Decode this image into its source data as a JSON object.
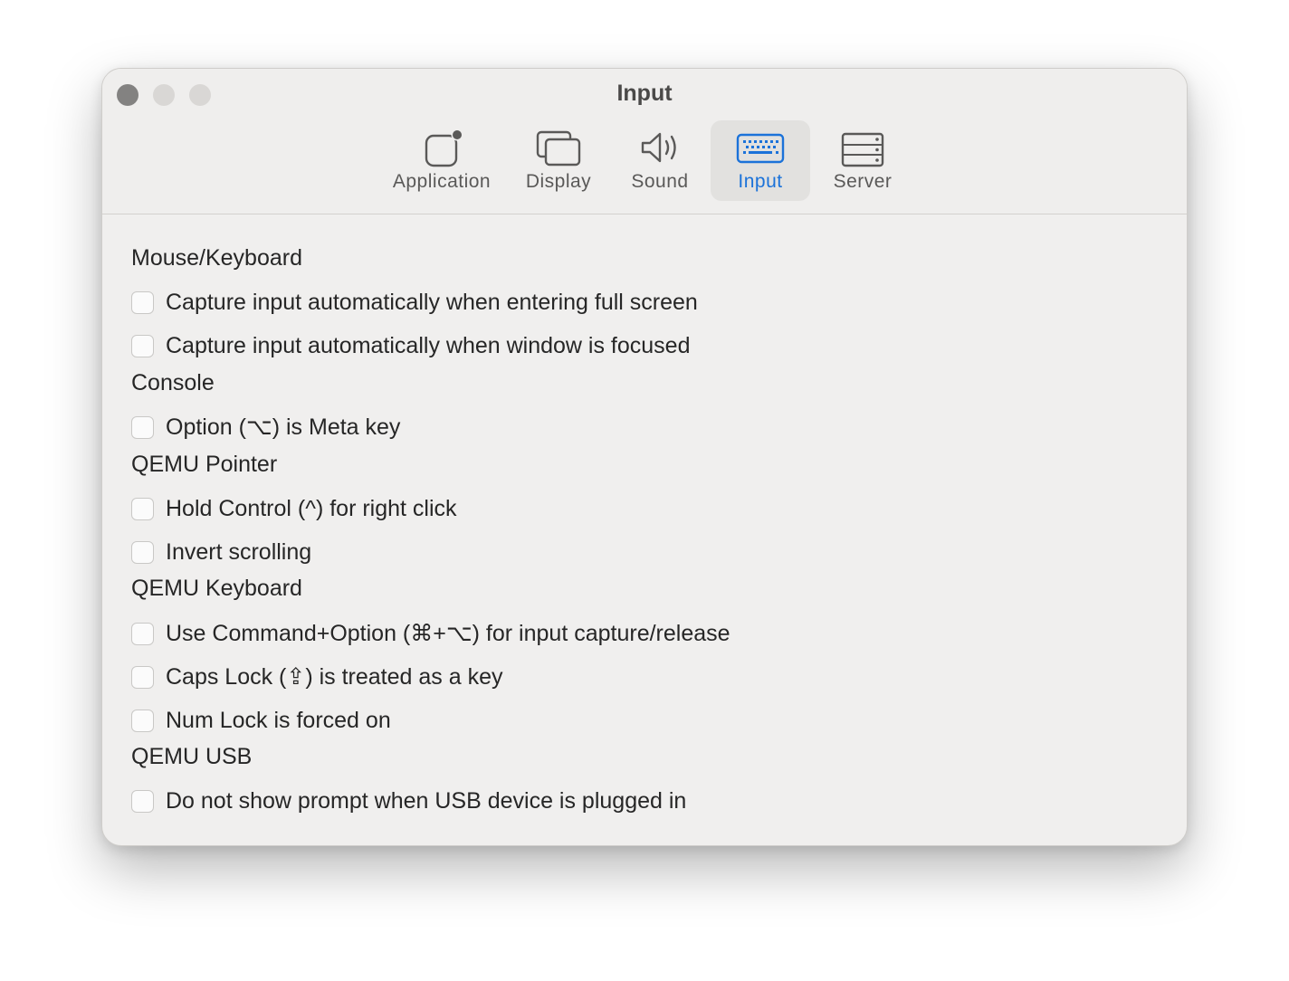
{
  "window": {
    "title": "Input"
  },
  "toolbar": {
    "tabs": [
      {
        "label": "Application",
        "icon": "application-icon",
        "selected": false
      },
      {
        "label": "Display",
        "icon": "display-icon",
        "selected": false
      },
      {
        "label": "Sound",
        "icon": "speaker-icon",
        "selected": false
      },
      {
        "label": "Input",
        "icon": "keyboard-icon",
        "selected": true
      },
      {
        "label": "Server",
        "icon": "server-icon",
        "selected": false
      }
    ]
  },
  "colors": {
    "accent": "#1b72d9",
    "window_bg": "#f0efee",
    "text": "#262626"
  },
  "sections": {
    "mouse_keyboard": {
      "label": "Mouse/Keyboard",
      "options": [
        {
          "label": "Capture input automatically when entering full screen",
          "checked": false
        },
        {
          "label": "Capture input automatically when window is focused",
          "checked": false
        }
      ]
    },
    "console": {
      "label": "Console",
      "options": [
        {
          "label": "Option (⌥) is Meta key",
          "checked": false
        }
      ]
    },
    "qemu_pointer": {
      "label": "QEMU Pointer",
      "options": [
        {
          "label": "Hold Control (^) for right click",
          "checked": false
        },
        {
          "label": "Invert scrolling",
          "checked": false
        }
      ]
    },
    "qemu_keyboard": {
      "label": "QEMU Keyboard",
      "options": [
        {
          "label": "Use Command+Option (⌘+⌥) for input capture/release",
          "checked": false
        },
        {
          "label": "Caps Lock (⇪) is treated as a key",
          "checked": false
        },
        {
          "label": "Num Lock is forced on",
          "checked": false
        }
      ]
    },
    "qemu_usb": {
      "label": "QEMU USB",
      "options": [
        {
          "label": "Do not show prompt when USB device is plugged in",
          "checked": false
        }
      ]
    }
  }
}
